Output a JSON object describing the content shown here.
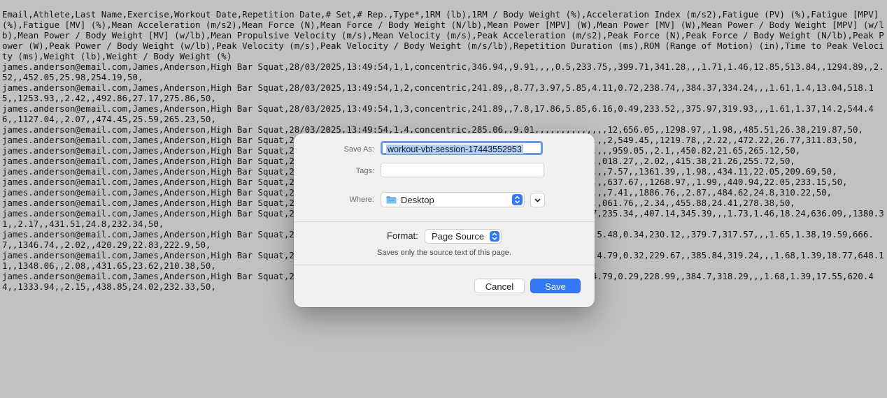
{
  "background": {
    "source_text": "Email,Athlete,Last Name,Exercise,Workout Date,Repetition Date,# Set,# Rep.,Type*,1RM (lb),1RM / Body Weight (%),Acceleration Index (m/s2),Fatigue (PV) (%),Fatigue [MPV] (%),Fatigue [MV] (%),Mean Acceleration (m/s2),Mean Force (N),Mean Force / Body Weight (N/lb),Mean Power [MPV] (W),Mean Power [MV] (W),Mean Power / Body Weight [MPV] (w/lb),Mean Power / Body Weight [MV] (w/lb),Mean Propulsive Velocity (m/s),Mean Velocity (m/s),Peak Acceleration (m/s2),Peak Force (N),Peak Force / Body Weight (N/lb),Peak Power (W),Peak Power / Body Weight (w/lb),Peak Velocity (m/s),Peak Velocity / Body Weight (m/s/lb),Repetition Duration (ms),ROM (Range of Motion) (in),Time to Peak Velocity (ms),Weight (lb),Weight / Body Weight (%)\njames.anderson@email.com,James,Anderson,High Bar Squat,28/03/2025,13:49:54,1,1,concentric,346.94,,9.91,,,,0.5,233.75,,399.71,341.28,,,1.71,1.46,12.85,513.84,,1294.89,,2.52,,452.05,25.98,254.19,50,\njames.anderson@email.com,James,Anderson,High Bar Squat,28/03/2025,13:49:54,1,2,concentric,241.89,,8.77,3.97,5.85,4.11,0.72,238.74,,384.37,334.24,,,1.61,1.4,13.04,518.15,,1253.93,,2.42,,492.86,27.17,275.86,50,\njames.anderson@email.com,James,Anderson,High Bar Squat,28/03/2025,13:49:54,1,3,concentric,241.89,,7.8,17.86,5.85,6.16,0.49,233.52,,375.97,319.93,,,1.61,1.37,14.2,544.46,,1127.04,,2.07,,474.45,25.59,265.23,50,\njames.anderson@email.com,James,Anderson,High Bar Squat,28/03/2025,13:49:54,1,4,concentric,285.06,,9.01,,,,,,,,,,,,,,12,656.05,,1298.97,,1.98,,485.51,26.38,219.87,50,\njames.anderson@email.com,James,Anderson,High Bar Squat,28/03/2025,13:49:54,1,5,concentric,346.94,,7.12,,,,,,,,,,,,,,2,549.45,,1219.78,,2.22,,472.22,26.77,311.83,50,\njames.anderson@email.com,James,Anderson,High Bar Squat,28/03/2025,13:50:06,2,1,concentric,162.94,,7.92,,,,,,,,,,,,,,,959.05,,2.1,,450.82,21.65,265.12,50,\njames.anderson@email.com,James,Anderson,High Bar Squat,28/03/2025,13:50:06,2,2,concentric,181.44,,7.9,,,,,,,,,,,,,,018.27,,2.02,,415.38,21.26,255.72,50,\njames.anderson@email.com,James,Anderson,High Bar Squat,28/03/2025,13:50:06,2,3,concentric,241.89,,9.44,,,,,,,,,,,,,,7.57,,1361.39,,1.98,,434.11,22.05,209.69,50,\njames.anderson@email.com,James,Anderson,High Bar Squat,28/03/2025,13:50:06,2,4,concentric,199.58,,8.54,,,,,,,,,,,,,,637.67,,1268.97,,1.99,,440.94,22.05,233.15,50,\njames.anderson@email.com,James,Anderson,High Bar Squat,28/03/2025,13:50:06,2,5,concentric,140.08,,9.25,,,,,,,,,,,,,,7.41,,1886.76,,2.87,,484.62,24.8,310.22,50,\njames.anderson@email.com,James,Anderson,High Bar Squat,28/03/2025,13:50:18,3,1,concentric,204.7,,8.41,,,,,,,,,,,,,,061.76,,2.34,,455.88,24.41,278.38,50,\njames.anderson@email.com,James,Anderson,High Bar Squat,28/03/2025,13:50:18,3,2,concentric,379.94,,9.34,7.26,,,0.57,235.34,,407.14,345.39,,,1.73,1.46,18.24,636.09,,1380.31,,2.17,,431.51,24.8,232.34,50,\njames.anderson@email.com,James,Anderson,High Bar Squat,28/03/2025,13:50:18,3,3,concentric,275.23,,9.06,13.68,4.62,5.48,0.34,230.12,,379.7,317.57,,,1.65,1.38,19.59,666.7,,1346.74,,2.02,,420.29,22.83,222.9,50,\njames.anderson@email.com,James,Anderson,High Bar Squat,28/03/2025,13:50:18,3,4,concentric,306.95,,9.89,11.11,2.89,4.79,0.32,229.67,,385.84,319.24,,,1.68,1.39,18.77,648.11,,1348.06,,2.08,,431.65,23.62,210.38,50,\njames.anderson@email.com,James,Anderson,High Bar Squat,28/03/2025,13:50:18,3,5,concentric,306.95,,9.25,8.12,2.89,4.79,0.29,228.99,,384.7,318.29,,,1.68,1.39,17.55,620.44,,1333.94,,2.15,,438.85,24.02,232.33,50,"
  },
  "dialog": {
    "save_as_label": "Save As:",
    "save_as_value": "workout-vbt-session-17443552953",
    "tags_label": "Tags:",
    "tags_value": "",
    "where_label": "Where:",
    "where_value": "Desktop",
    "where_icon": "folder-icon",
    "format_label": "Format:",
    "format_value": "Page Source",
    "format_description": "Saves only the source text of this page.",
    "cancel_label": "Cancel",
    "save_label": "Save"
  },
  "colors": {
    "accent": "#3478f6",
    "selection": "#b1ccf3",
    "folder": "#5aa9e6"
  }
}
